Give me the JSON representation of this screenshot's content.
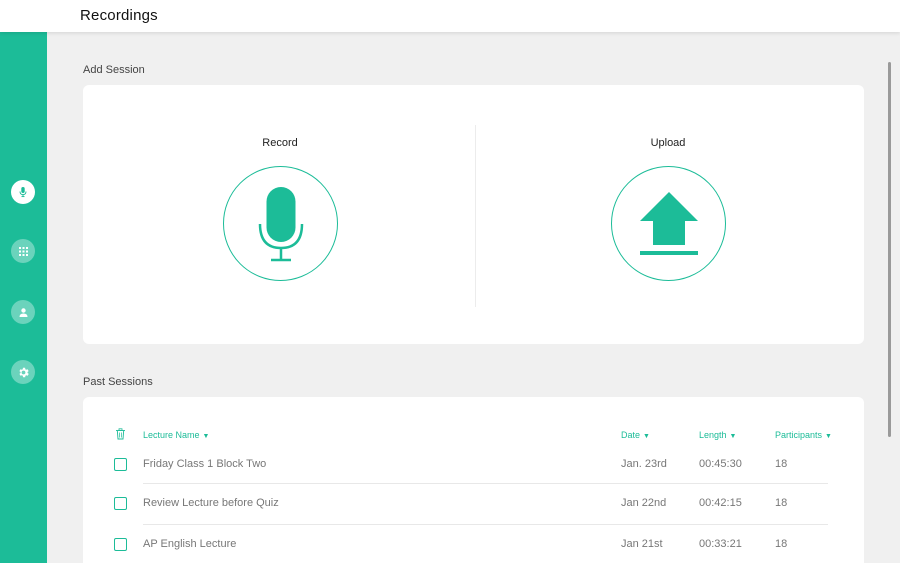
{
  "header": {
    "title": "Recordings"
  },
  "sidebar": {
    "items": [
      {
        "icon": "microphone-icon",
        "active": true
      },
      {
        "icon": "grid-icon",
        "active": false
      },
      {
        "icon": "user-icon",
        "active": false
      },
      {
        "icon": "gear-icon",
        "active": false
      }
    ]
  },
  "add_session": {
    "label": "Add Session",
    "record_label": "Record",
    "upload_label": "Upload"
  },
  "past_sessions": {
    "label": "Past Sessions",
    "columns": {
      "name": "Lecture Name",
      "date": "Date",
      "length": "Length",
      "participants": "Participants"
    },
    "rows": [
      {
        "name": "Friday Class 1 Block Two",
        "date": "Jan. 23rd",
        "length": "00:45:30",
        "participants": "18"
      },
      {
        "name": "Review Lecture before Quiz",
        "date": "Jan 22nd",
        "length": "00:42:15",
        "participants": "18"
      },
      {
        "name": "AP English Lecture",
        "date": "Jan 21st",
        "length": "00:33:21",
        "participants": "18"
      }
    ]
  },
  "colors": {
    "accent": "#1cbc98",
    "background": "#f0f0f0",
    "card": "#ffffff"
  }
}
